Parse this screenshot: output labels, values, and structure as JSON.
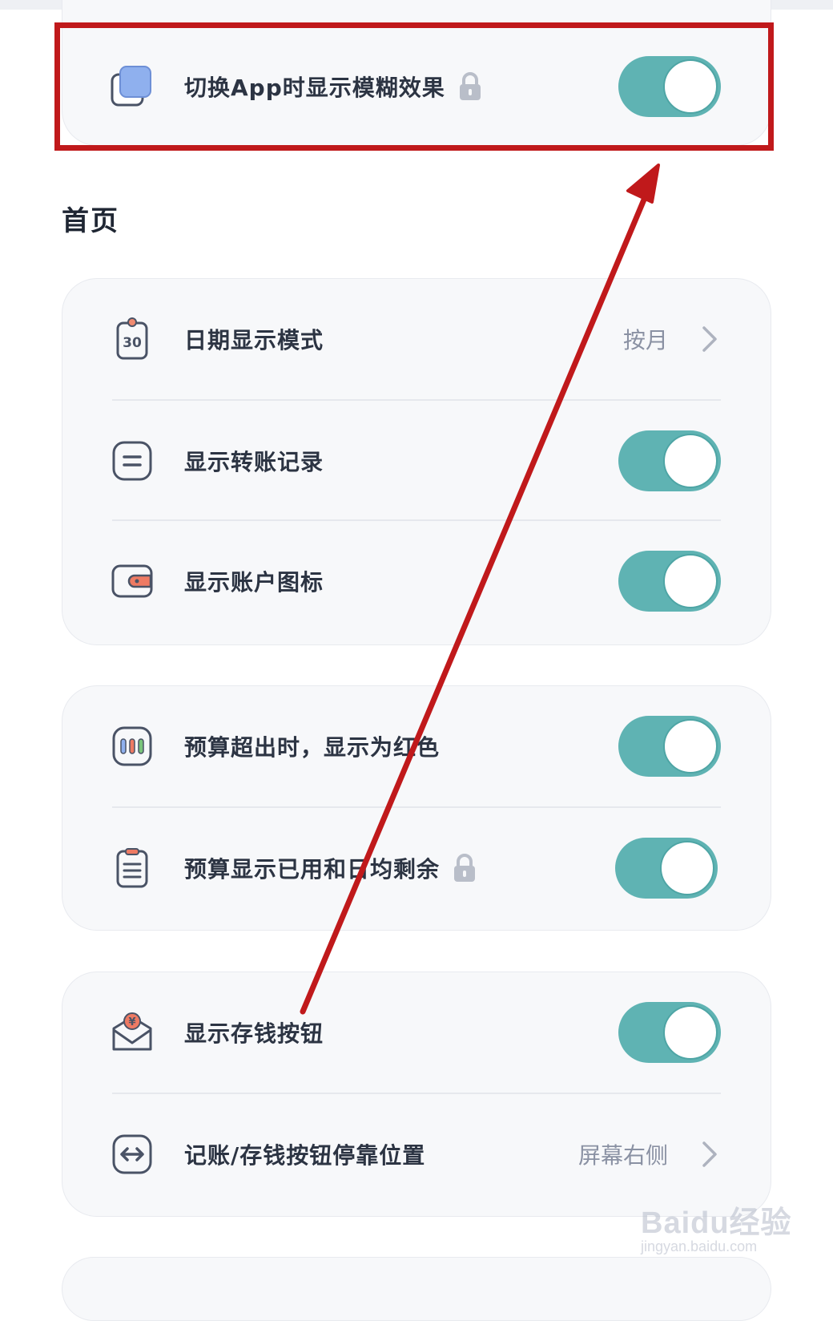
{
  "top_setting": {
    "label": "切换App时显示模糊效果",
    "icon": "blur-windows-icon",
    "locked": true,
    "enabled": true
  },
  "homepage_section": {
    "title": "首页"
  },
  "group1": {
    "date_mode": {
      "label": "日期显示模式",
      "value": "按月",
      "icon": "calendar-30-icon"
    },
    "show_transfers": {
      "label": "显示转账记录",
      "enabled": true,
      "icon": "transfer-record-icon"
    },
    "show_account_icons": {
      "label": "显示账户图标",
      "enabled": true,
      "icon": "wallet-icon"
    }
  },
  "group2": {
    "budget_red": {
      "label": "预算超出时，显示为红色",
      "enabled": true,
      "icon": "budget-bars-icon"
    },
    "budget_used_daily": {
      "label": "预算显示已用和日均剩余",
      "locked": true,
      "enabled": true,
      "icon": "clipboard-list-icon"
    }
  },
  "group3": {
    "show_savings_button": {
      "label": "显示存钱按钮",
      "enabled": true,
      "icon": "savings-envelope-icon"
    },
    "button_dock_position": {
      "label": "记账/存钱按钮停靠位置",
      "value": "屏幕右侧",
      "icon": "left-right-arrows-icon"
    }
  },
  "watermark": {
    "brand": "Baidu经验",
    "url": "jingyan.baidu.com"
  },
  "colors": {
    "toggle_on": "#5fb3b3",
    "card_bg": "#f7f8fa",
    "annotation_red": "#c0191b",
    "value_text": "#8a91a3"
  }
}
